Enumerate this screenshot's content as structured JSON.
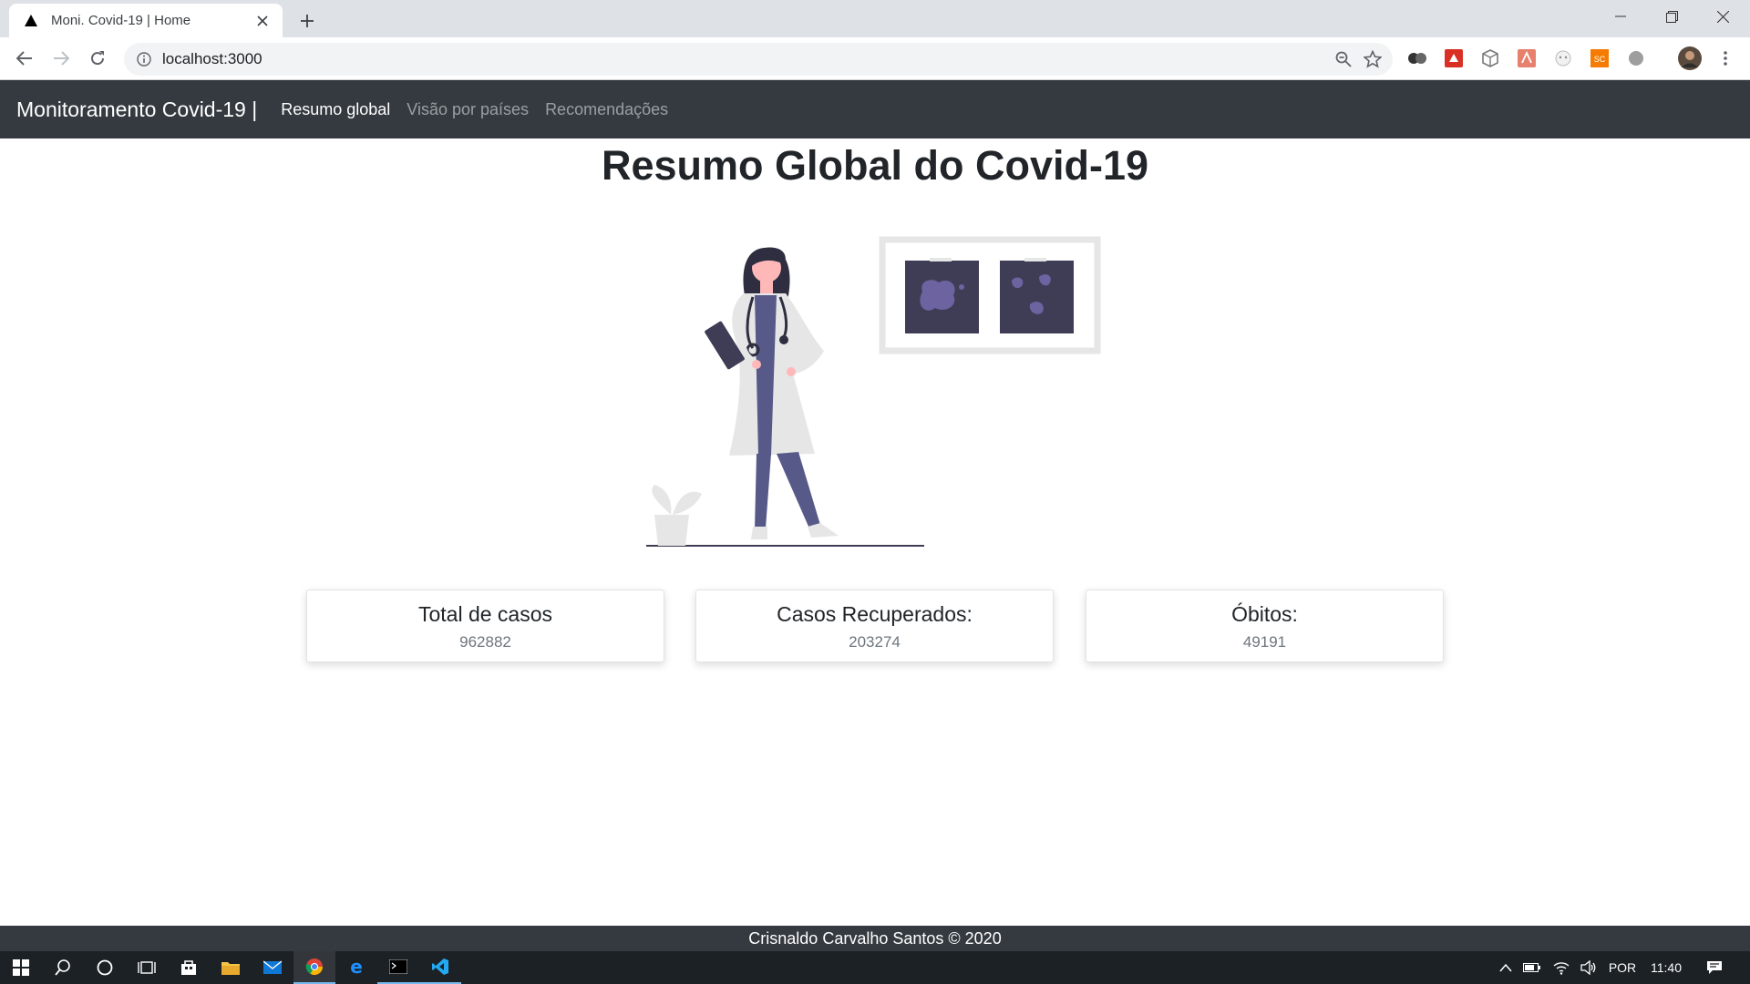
{
  "browser": {
    "tab_title": "Moni. Covid-19 | Home",
    "url": "localhost:3000"
  },
  "nav": {
    "brand": "Monitoramento Covid-19 |",
    "links": [
      {
        "label": "Resumo global",
        "active": true
      },
      {
        "label": "Visão por países",
        "active": false
      },
      {
        "label": "Recomendações",
        "active": false
      }
    ]
  },
  "page": {
    "title": "Resumo Global do Covid-19"
  },
  "cards": [
    {
      "title": "Total de casos",
      "value": "962882"
    },
    {
      "title": "Casos Recuperados:",
      "value": "203274"
    },
    {
      "title": "Óbitos:",
      "value": "49191"
    }
  ],
  "footer": {
    "text": "Crisnaldo Carvalho Santos © 2020"
  },
  "taskbar": {
    "language": "POR",
    "time": "11:40"
  },
  "colors": {
    "navbar_bg": "#343a40",
    "illustration_dark": "#3f3d56",
    "illustration_light": "#e6e6e6",
    "accent_skin": "#ffb8b8"
  }
}
